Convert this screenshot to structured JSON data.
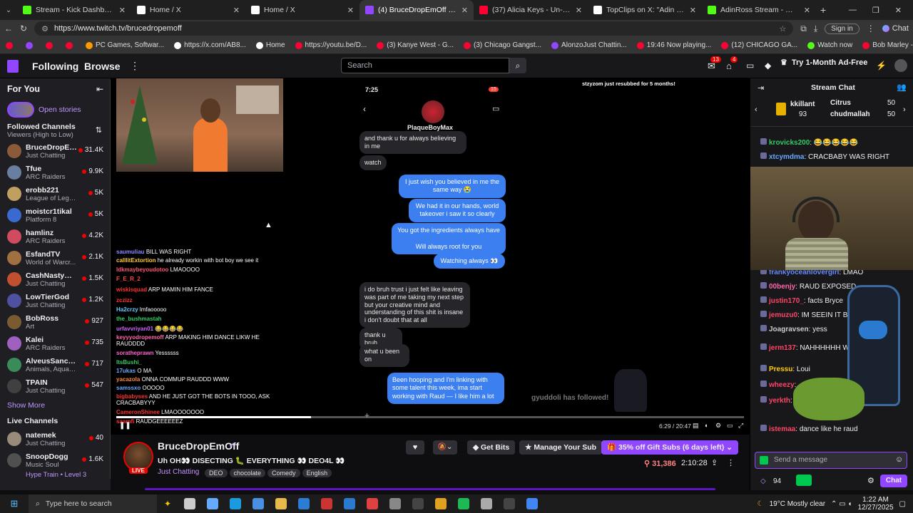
{
  "browser": {
    "tabs": [
      {
        "title": "Stream - Kick Dashboard",
        "color": "#53fc18"
      },
      {
        "title": "Home / X",
        "color": "#ffffff"
      },
      {
        "title": "Home / X",
        "color": "#ffffff"
      },
      {
        "title": "(4) BruceDropEmOff - Twitch",
        "color": "#9146ff"
      },
      {
        "title": "(37) Alicia Keys - Un-thinkable (I'm",
        "color": "#ff0033"
      },
      {
        "title": "TopClips on X: \"Adin Ross defend",
        "color": "#ffffff"
      },
      {
        "title": "AdinRoss Stream - Watch Live on",
        "color": "#53fc18"
      }
    ],
    "url": "https://www.twitch.tv/brucedropemoff",
    "sign_in": "Sign in",
    "chat_label": "Chat",
    "bookmarks": [
      {
        "label": "",
        "color": "#ff0033"
      },
      {
        "label": "",
        "color": "#9146ff"
      },
      {
        "label": "",
        "color": "#ff0033"
      },
      {
        "label": "",
        "color": "#ff0033"
      },
      {
        "label": "PC Games, Softwar...",
        "color": "#ff9900"
      },
      {
        "label": "https://x.com/AB8...",
        "color": "#ffffff"
      },
      {
        "label": "Home",
        "color": "#ffffff"
      },
      {
        "label": "https://youtu.be/D...",
        "color": "#ff0033"
      },
      {
        "label": "(3) Kanye West - G...",
        "color": "#ff0033"
      },
      {
        "label": "(3) Chicago Gangst...",
        "color": "#ff0033"
      },
      {
        "label": "AlonzoJust Chattin...",
        "color": "#9146ff"
      },
      {
        "label": "19:46 Now playing...",
        "color": "#ff0033"
      },
      {
        "label": "(12) CHICAGO GA...",
        "color": "#ff0033"
      },
      {
        "label": "Watch now",
        "color": "#53fc18"
      },
      {
        "label": "Bob Marley - Waiti...",
        "color": "#ff0033"
      }
    ]
  },
  "nav": {
    "following": "Following",
    "browse": "Browse",
    "search_placeholder": "Search",
    "inbox_badge": "13",
    "notif_badge": "4",
    "ad_free": "Try 1-Month Ad-Free"
  },
  "sidebar": {
    "for_you": "For You",
    "open_stories": "Open stories",
    "followed_heading": "Followed Channels",
    "followed_sub": "Viewers (High to Low)",
    "channels": [
      {
        "name": "BruceDropEm...",
        "category": "Just Chatting",
        "viewers": "31.4K",
        "color": "#8a5a3a"
      },
      {
        "name": "Tfue",
        "category": "ARC Raiders",
        "viewers": "9.9K",
        "color": "#6a7fa0"
      },
      {
        "name": "erobb221",
        "category": "League of Lege...",
        "viewers": "5K",
        "color": "#c0a060"
      },
      {
        "name": "moistcr1tikal",
        "category": "Platform 8",
        "viewers": "5K",
        "color": "#3a6ad0"
      },
      {
        "name": "hamlinz",
        "category": "ARC Raiders",
        "viewers": "4.2K",
        "color": "#d04a60"
      },
      {
        "name": "EsfandTV",
        "category": "World of Warcr...",
        "viewers": "2.1K",
        "color": "#a07040"
      },
      {
        "name": "CashNastyGam...",
        "category": "Just Chatting",
        "viewers": "1.5K",
        "color": "#c05030"
      },
      {
        "name": "LowTierGod",
        "category": "Just Chatting",
        "viewers": "1.2K",
        "color": "#5050a0"
      },
      {
        "name": "BobRoss",
        "category": "Art",
        "viewers": "927",
        "color": "#7a5a30"
      },
      {
        "name": "Kalei",
        "category": "ARC Raiders",
        "viewers": "735",
        "color": "#a060c0"
      },
      {
        "name": "AlveusSanctuary",
        "category": "Animals, Aquari...",
        "viewers": "717",
        "color": "#3a8a5a"
      },
      {
        "name": "TPAIN",
        "category": "Just Chatting",
        "viewers": "547",
        "color": "#404040"
      }
    ],
    "show_more": "Show More",
    "live_heading": "Live Channels",
    "live": [
      {
        "name": "natemek",
        "category": "Just Chatting",
        "viewers": "40",
        "color": "#9a8a7a"
      },
      {
        "name": "SnoopDogg",
        "category": "Music Soul",
        "viewers": "1.6K",
        "color": "#505050"
      }
    ],
    "hype_train": "Hype Train • Level 3"
  },
  "player": {
    "phone_time": "7:25",
    "contact": "PlaqueBoyMax",
    "badge": "15",
    "sub_notice": "stzyzom just resubbed for 5 months!",
    "follow_notice": "gyuddoli has followed!",
    "messages_left": [
      {
        "text": "and thank u for always believing in me"
      },
      {
        "text": "watch"
      },
      {
        "text": "i do bruh trust i just felt like leaving was part of me taking my next step but your creative mind and understanding of this shit is insane i don't doubt that at all"
      },
      {
        "text": "thank u bruh"
      },
      {
        "text": "what u been on"
      }
    ],
    "messages_right": [
      {
        "text": "I just wish you believed in me the same way 😭"
      },
      {
        "text": "We had it in our hands, world takeover i saw it so clearly"
      },
      {
        "text": "You got the ingredients always have\n\nWill always root for you"
      },
      {
        "text": "Watching always 👀"
      },
      {
        "text": "Been hooping and I'm linking with some talent this week, ima start working with Raud — I like him a lot"
      }
    ],
    "overlay_chat": [
      {
        "user": "saumuliau",
        "msg": "BILL WAS RIGHT",
        "color": "#8a8aff"
      },
      {
        "user": "calllitExtortion",
        "msg": "he already workin with bot boy we see it",
        "color": "#ffcc33"
      },
      {
        "user": "ldkmaybeyoudotoo",
        "msg": "LMAOOOO",
        "color": "#ff5577"
      },
      {
        "user": "F_E_R_2",
        "msg": "",
        "color": "#ff4444"
      },
      {
        "user": "wiskisquad",
        "msg": "ARP MAMIN HIM FANCE",
        "color": "#ff3333"
      },
      {
        "user": "zczizz",
        "msg": "",
        "color": "#ff3333"
      },
      {
        "user": "Ha2crzy",
        "msg": "lmfaooooo",
        "color": "#66ccff"
      },
      {
        "user": "the_bushmastah",
        "msg": "",
        "color": "#33cc66"
      },
      {
        "user": "urfavvriyan01",
        "msg": "😂😂😂😂",
        "color": "#cc66ff"
      },
      {
        "user": "keyyyodropemoff",
        "msg": "ARP MAKING HIM DANCE LIKW HE RAUDDDD",
        "color": "#ff66aa"
      },
      {
        "user": "soratheprawn",
        "msg": "Yessssss",
        "color": "#ff66cc"
      },
      {
        "user": "ItsBushi_",
        "msg": "",
        "color": "#33cc66"
      },
      {
        "user": "17ukas",
        "msg": "O MA",
        "color": "#66aaff"
      },
      {
        "user": "yacazola",
        "msg": "ONNA COMMUP RAUDDD WWW",
        "color": "#ff8833"
      },
      {
        "user": "samssxo",
        "msg": "OOOOO",
        "color": "#66aaff"
      },
      {
        "user": "bigbabyses",
        "msg": "AND HE JUST GOT THE BOTS IN TOOO, ASK CRACBABYYY",
        "color": "#ff3333"
      },
      {
        "user": "CameronShinee",
        "msg": "LMAOOOOOOO",
        "color": "#ff3333"
      },
      {
        "user": "saamfi",
        "msg": "RAUDGEEEEEEZ",
        "color": "#ff3333"
      }
    ],
    "time_display": "6:29 / 20:47",
    "progress": 0.31
  },
  "stream": {
    "channel": "BruceDropEmOff",
    "title": "Uh OH👀 DISECTING 🐛 EVERYTHING 👀 DEO4L 👀",
    "category": "Just Chatting",
    "tags": [
      "DEO",
      "chocolate",
      "Comedy",
      "English"
    ],
    "live_label": "LIVE",
    "get_bits": "Get Bits",
    "manage_sub": "Manage Your Sub",
    "gift_subs": "35% off Gift Subs (6 days left)",
    "viewers": "31,386",
    "uptime": "2:10:28"
  },
  "chat": {
    "title": "Stream Chat",
    "leaders": [
      {
        "name": "kkillant",
        "count": "93"
      },
      {
        "name": "Citrus",
        "count": "50"
      },
      {
        "name": "chudmallah",
        "count": "50"
      }
    ],
    "messages": [
      {
        "user": "krovicks200",
        "msg": "😂😂😂😂😂",
        "color": "#33cc66"
      },
      {
        "user": "xtcymdma",
        "msg": "CRACBABY WAS RIGHT",
        "color": "#66aaff"
      },
      {
        "user": "frankyoceanlovergirl",
        "msg": "LMAO",
        "color": "#6688ff"
      },
      {
        "user": "00benjy",
        "msg": "RAUD EXPOSED",
        "color": "#ff66aa"
      },
      {
        "user": "justin170_",
        "msg": "facts Bryce",
        "color": "#ff4466"
      },
      {
        "user": "jemuzu0",
        "msg": "IM SEEIN IT B5",
        "color": "#ff4466"
      },
      {
        "user": "Joagravsen",
        "msg": "yess",
        "color": "#cccccc"
      },
      {
        "user": "jerm137",
        "msg": "NAHHHHHH WHAAAAT",
        "color": "#ff4466"
      },
      {
        "user": "Pressu",
        "msg": "Loui",
        "color": "#ffcc00"
      },
      {
        "user": "wheezy",
        "msg": "",
        "color": "#ff4466"
      },
      {
        "user": "yerkth",
        "msg": "",
        "color": "#ff4466"
      },
      {
        "user": "istemaa",
        "msg": "dance like he raud",
        "color": "#ff4466"
      }
    ],
    "input_placeholder": "Send a message",
    "points": "94",
    "chat_button": "Chat"
  },
  "taskbar": {
    "search_placeholder": "Type here to search",
    "weather": "19°C  Mostly clear",
    "time": "1:22 AM",
    "date": "12/27/2025"
  }
}
